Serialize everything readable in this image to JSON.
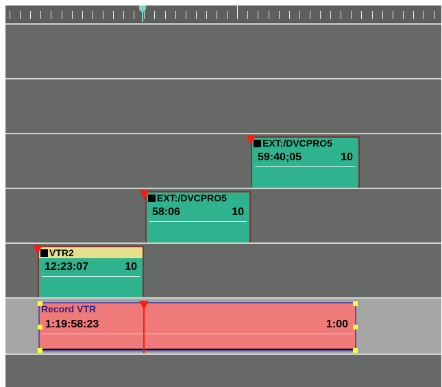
{
  "timeline": {
    "tracks": [
      {
        "clip": null
      },
      {
        "clip": null
      },
      {
        "clip": {
          "label": "EXT:/DVCPRO5",
          "timecode": "59:40;05",
          "value": "10"
        }
      },
      {
        "clip": {
          "label": "EXT:/DVCPRO5",
          "timecode": "58:06",
          "value": "10"
        }
      },
      {
        "clip": {
          "label": "VTR2",
          "timecode": "12:23:07",
          "value": "10"
        }
      }
    ],
    "record_track": {
      "label": "Record VTR",
      "timecode": "1:19:58:23",
      "duration": "1:00"
    }
  },
  "colors": {
    "background": "#666966",
    "record_track": "#a3a6a3",
    "clip_fill": "#2fb38f",
    "clip_border": "#7a3630",
    "vtr2_header": "#e6df8c",
    "record_clip_fill": "#f07a7a",
    "marker_red": "#ff1a10",
    "handle_yellow": "#ffff33",
    "playhead": "#7ad3c9"
  }
}
